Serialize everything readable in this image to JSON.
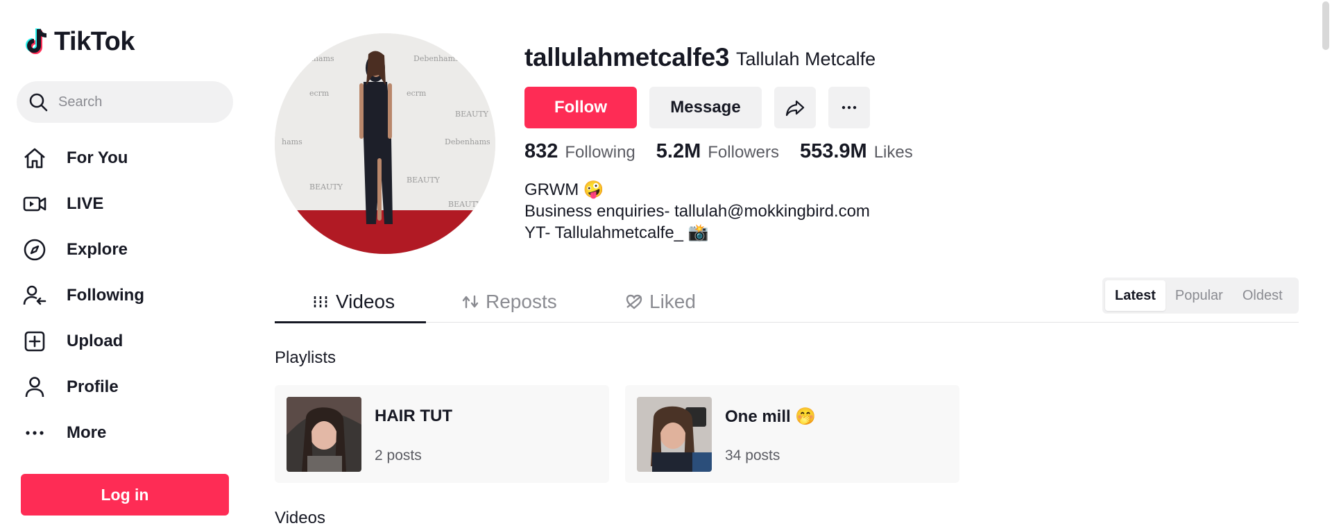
{
  "brand": {
    "name": "TikTok",
    "accent": "#fe2c55"
  },
  "search": {
    "placeholder": "Search",
    "value": ""
  },
  "nav": [
    {
      "label": "For You",
      "icon": "home-icon"
    },
    {
      "label": "LIVE",
      "icon": "live-icon"
    },
    {
      "label": "Explore",
      "icon": "compass-icon"
    },
    {
      "label": "Following",
      "icon": "following-icon"
    },
    {
      "label": "Upload",
      "icon": "upload-icon"
    },
    {
      "label": "Profile",
      "icon": "profile-icon"
    },
    {
      "label": "More",
      "icon": "more-icon"
    }
  ],
  "login_label": "Log in",
  "profile": {
    "username": "tallulahmetcalfe3",
    "display_name": "Tallulah Metcalfe",
    "follow_label": "Follow",
    "message_label": "Message",
    "stats": [
      {
        "value": "832",
        "label": "Following"
      },
      {
        "value": "5.2M",
        "label": "Followers"
      },
      {
        "value": "553.9M",
        "label": "Likes"
      }
    ],
    "bio": [
      "GRWM 🤪",
      "Business enquiries- tallulah@mokkingbird.com",
      "YT- Tallulahmetcalfe_ 📸"
    ]
  },
  "tabs": [
    {
      "label": "Videos",
      "icon": "grid-icon",
      "active": true
    },
    {
      "label": "Reposts",
      "icon": "repost-icon",
      "active": false
    },
    {
      "label": "Liked",
      "icon": "heart-icon",
      "active": false
    }
  ],
  "sort": [
    {
      "label": "Latest",
      "active": true
    },
    {
      "label": "Popular",
      "active": false
    },
    {
      "label": "Oldest",
      "active": false
    }
  ],
  "playlists_title": "Playlists",
  "playlists": [
    {
      "title": "HAIR TUT",
      "count": "2 posts"
    },
    {
      "title": "One mill 🤭",
      "count": "34 posts"
    }
  ],
  "videos_title": "Videos"
}
